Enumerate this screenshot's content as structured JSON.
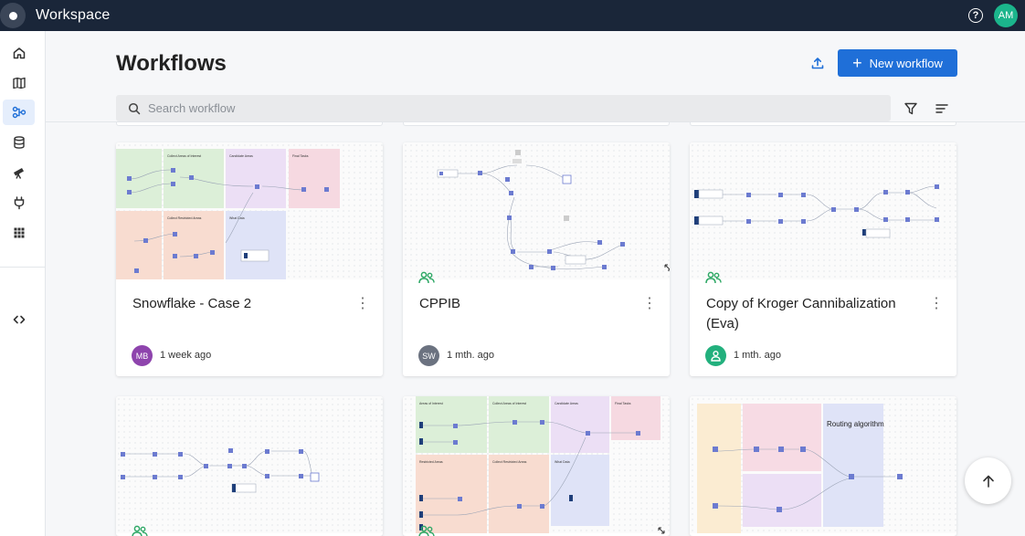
{
  "app": {
    "title": "Workspace",
    "user_initials": "AM",
    "help_icon": "help-circle-icon"
  },
  "sidebar": {
    "items": [
      {
        "icon": "home-icon"
      },
      {
        "icon": "map-icon"
      },
      {
        "icon": "workflow-icon",
        "active": true
      },
      {
        "icon": "database-icon"
      },
      {
        "icon": "telescope-icon"
      },
      {
        "icon": "plug-icon"
      },
      {
        "icon": "apps-grid-icon"
      },
      {
        "icon": "code-icon"
      }
    ]
  },
  "page": {
    "title": "Workflows"
  },
  "toolbar": {
    "upload_icon": "upload-icon",
    "new_label": "New workflow",
    "filter_icon": "filter-icon",
    "sort_icon": "sort-icon"
  },
  "search": {
    "placeholder": "Search workflow",
    "value": ""
  },
  "cards": [
    {
      "title": "Snowflake - Case 2",
      "owner_initials": "MB",
      "owner_color": "#8e44ad",
      "time": "1 week ago"
    },
    {
      "title": "CPPIB",
      "owner_initials": "SW",
      "owner_color": "#6b7280",
      "time": "1 mth. ago"
    },
    {
      "title": "Copy of Kroger Cannibalization (Eva)",
      "owner_initials": "",
      "owner_color": "#22b07d",
      "time": "1 mth. ago"
    },
    {
      "title": "",
      "owner_initials": "",
      "time": ""
    },
    {
      "title": "",
      "owner_initials": "",
      "time": ""
    },
    {
      "title": "",
      "owner_initials": "",
      "time": ""
    }
  ],
  "thumb_labels": {
    "c1": {
      "a": "Collect Areas of Interest",
      "b": "Candidate Areas",
      "c": "Final Tasks",
      "d": "Collect Restricted Areas",
      "e": "What Data"
    },
    "c5": {
      "a": "Areas of Interest",
      "b": "Collect Areas of Interest",
      "c": "Candidate Areas",
      "d": "Final Tasks",
      "e": "Restricted Areas",
      "f": "Collect Restricted Areas",
      "g": "What Data"
    },
    "c6": {
      "a": "Routing algorithm"
    }
  },
  "colors": {
    "accent": "#1f6fd8",
    "topbar": "#1a2639",
    "active_nav": "#e5eefc",
    "share": "#2fa866"
  }
}
